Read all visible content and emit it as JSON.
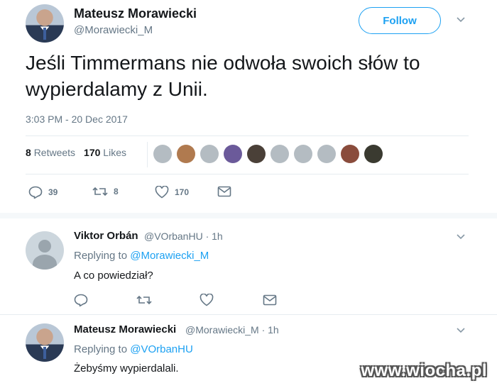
{
  "main_tweet": {
    "author_name": "Mateusz Morawiecki",
    "author_handle": "@Morawiecki_M",
    "follow_label": "Follow",
    "text": "Jeśli Timmermans nie odwoła swoich słów to wypierdalamy z Unii.",
    "timestamp": "3:03 PM - 20 Dec 2017",
    "retweets_count": "8",
    "retweets_label": "Retweets",
    "likes_count": "170",
    "likes_label": "Likes",
    "liker_avatar_colors": [
      "#b4bcc2",
      "#b07a4f",
      "#b4bcc2",
      "#6b5a9a",
      "#4a4038",
      "#b4bcc2",
      "#b4bcc2",
      "#b4bcc2",
      "#8a4c3c",
      "#3a3a30"
    ],
    "actions": {
      "replies": "39",
      "retweets": "8",
      "likes": "170"
    }
  },
  "reply_1": {
    "author_name": "Viktor Orbán",
    "author_handle": "@VOrbanHU",
    "age": "· 1h",
    "replying_prefix": "Replying to",
    "replying_to": "@Morawiecki_M",
    "text": "A co powiedział?"
  },
  "reply_2": {
    "author_name": "Mateusz Morawiecki",
    "author_handle": "@Morawiecki_M",
    "age": "· 1h",
    "replying_prefix": "Replying to",
    "replying_to": "@VOrbanHU",
    "text": "Żebyśmy wypierdalali."
  },
  "watermark": "www.wiocha.pl",
  "colors": {
    "accent": "#1da1f2",
    "secondary_text": "#657786",
    "divider": "#e6ecf0"
  }
}
